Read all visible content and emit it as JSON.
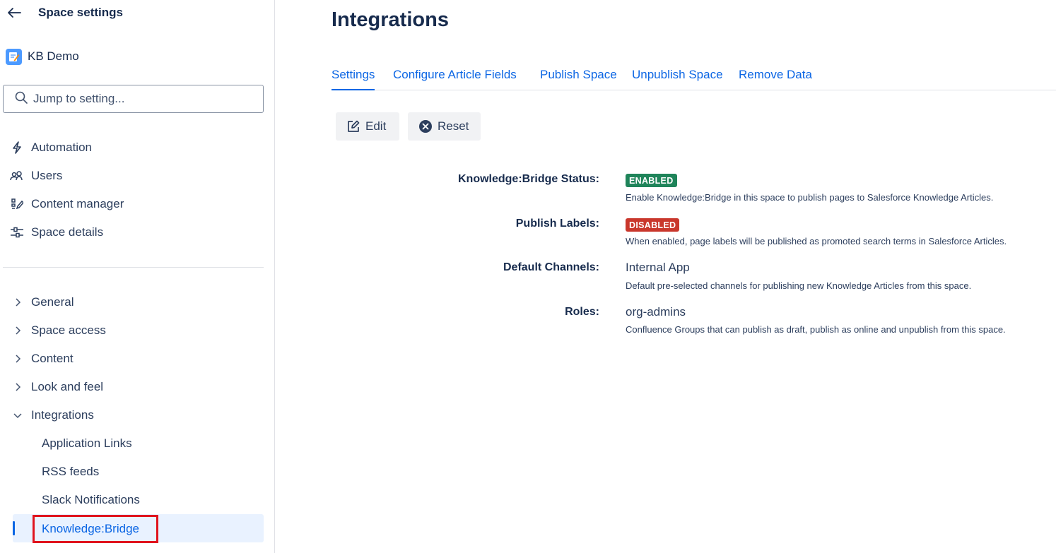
{
  "sidebar": {
    "title": "Space settings",
    "space_name": "KB Demo",
    "search_placeholder": "Jump to setting...",
    "primary_items": [
      {
        "label": "Automation",
        "icon": "lightning-icon"
      },
      {
        "label": "Users",
        "icon": "users-icon"
      },
      {
        "label": "Content manager",
        "icon": "content-manager-icon"
      },
      {
        "label": "Space details",
        "icon": "space-details-icon"
      }
    ],
    "tree": [
      {
        "label": "General",
        "expanded": false
      },
      {
        "label": "Space access",
        "expanded": false
      },
      {
        "label": "Content",
        "expanded": false
      },
      {
        "label": "Look and feel",
        "expanded": false
      },
      {
        "label": "Integrations",
        "expanded": true
      }
    ],
    "integrations_children": [
      "Application Links",
      "RSS feeds",
      "Slack Notifications",
      "Knowledge:Bridge"
    ],
    "active_item": "Knowledge:Bridge"
  },
  "main": {
    "title": "Integrations",
    "tabs": [
      "Settings",
      "Configure Article Fields",
      "Publish Space",
      "Unpublish Space",
      "Remove Data"
    ],
    "active_tab": "Settings",
    "buttons": {
      "edit": "Edit",
      "reset": "Reset"
    },
    "settings": [
      {
        "label": "Knowledge:Bridge Status:",
        "badge": "ENABLED",
        "badge_color": "#1f845a",
        "description": "Enable Knowledge:Bridge in this space to publish pages to Salesforce Knowledge Articles."
      },
      {
        "label": "Publish Labels:",
        "badge": "DISABLED",
        "badge_color": "#c9372c",
        "description": "When enabled, page labels will be published as promoted search terms in Salesforce Articles."
      },
      {
        "label": "Default Channels:",
        "value": "Internal App",
        "description": "Default pre-selected channels for publishing new Knowledge Articles from this space."
      },
      {
        "label": "Roles:",
        "value": "org-admins",
        "description": "Confluence Groups that can publish as draft, publish as online and unpublish from this space."
      }
    ]
  },
  "colors": {
    "accent": "#0c66e4",
    "highlight_border": "#e0141e",
    "active_bg": "#e9f2ff"
  }
}
